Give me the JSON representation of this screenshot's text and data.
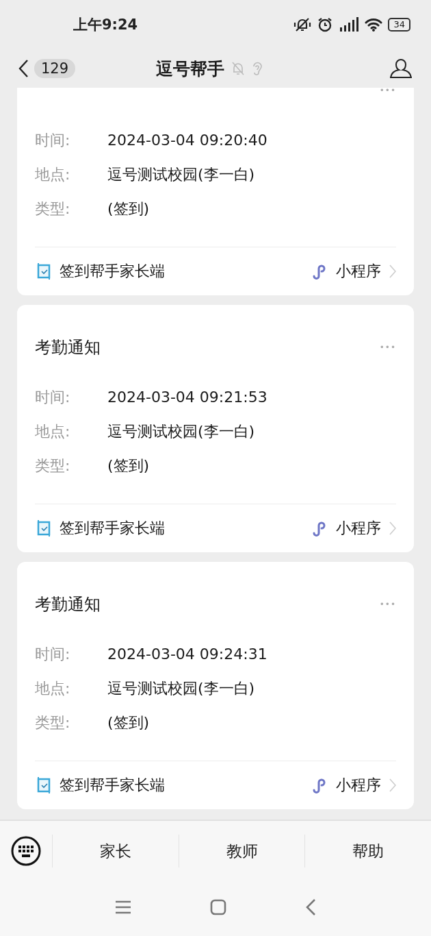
{
  "status_bar": {
    "time": "上午9:24",
    "battery": "34"
  },
  "header": {
    "unread_count": "129",
    "title": "逗号帮手",
    "muted": true
  },
  "cards": [
    {
      "more": "•••",
      "fields": [
        {
          "label": "时间:",
          "value": "2024-03-04 09:20:40"
        },
        {
          "label": "地点:",
          "value": "逗号测试校园(李一白)"
        },
        {
          "label": "类型:",
          "value": "(签到)"
        }
      ],
      "app_name": "签到帮手家长端",
      "link_label": "小程序"
    },
    {
      "title": "考勤通知",
      "more": "•••",
      "fields": [
        {
          "label": "时间:",
          "value": "2024-03-04 09:21:53"
        },
        {
          "label": "地点:",
          "value": "逗号测试校园(李一白)"
        },
        {
          "label": "类型:",
          "value": "(签到)"
        }
      ],
      "app_name": "签到帮手家长端",
      "link_label": "小程序"
    },
    {
      "title": "考勤通知",
      "more": "•••",
      "fields": [
        {
          "label": "时间:",
          "value": "2024-03-04 09:24:31"
        },
        {
          "label": "地点:",
          "value": "逗号测试校园(李一白)"
        },
        {
          "label": "类型:",
          "value": "(签到)"
        }
      ],
      "app_name": "签到帮手家长端",
      "link_label": "小程序"
    }
  ],
  "menu_tabs": [
    {
      "label": "家长"
    },
    {
      "label": "教师"
    },
    {
      "label": "帮助"
    }
  ]
}
